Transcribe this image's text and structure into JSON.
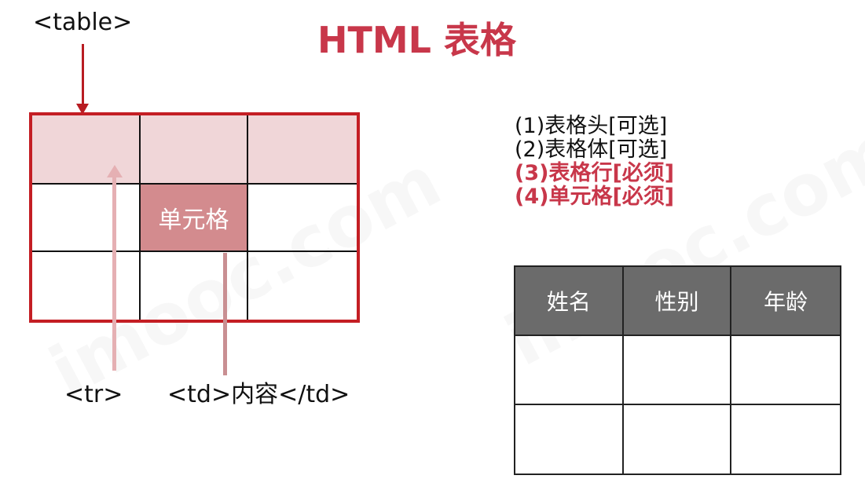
{
  "title": "HTML 表格",
  "labels": {
    "table": "<table>",
    "tr": "<tr>",
    "td": "<td>内容</td>"
  },
  "diagram": {
    "cell_text": "单元格"
  },
  "list": [
    {
      "text": "(1)表格头[可选]",
      "required": false
    },
    {
      "text": "(2)表格体[可选]",
      "required": false
    },
    {
      "text": "(3)表格行[必须]",
      "required": true
    },
    {
      "text": "(4)单元格[必须]",
      "required": true
    }
  ],
  "example_table": {
    "headers": [
      "姓名",
      "性别",
      "年龄"
    ]
  },
  "watermark": "imooc.com",
  "colors": {
    "accent": "#c8374a",
    "border_red": "#c41e24",
    "header_pink": "#f0d6d8",
    "cell_highlight": "#d38b8e",
    "table_header_gray": "#6b6b6b"
  }
}
